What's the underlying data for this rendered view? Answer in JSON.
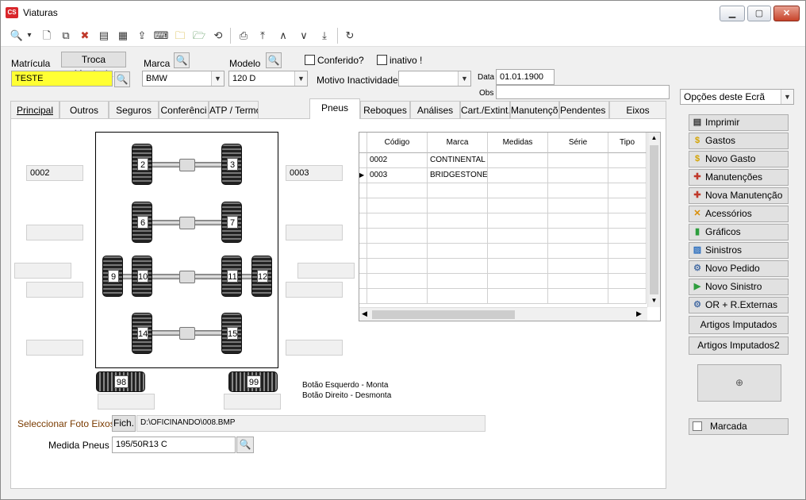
{
  "window": {
    "title": "Viaturas",
    "logo": "CS",
    "minimize": "▁",
    "maximize": "▢",
    "close": "✕"
  },
  "toolbar": {
    "icons": [
      "search-icon",
      "dropdown-arrow-icon",
      "new-document-icon",
      "copy-document-icon",
      "delete-icon",
      "report-icon",
      "table-icon",
      "import-icon",
      "keyboard-icon",
      "find-folder-icon",
      "folder-icon",
      "refresh-icon",
      "preview-icon",
      "first-icon",
      "previous-icon",
      "next-icon",
      "last-icon",
      "reload-icon"
    ],
    "glyphs": {
      "search": "🔍",
      "dropdown": "▾",
      "new": "🗋",
      "copy": "⧉",
      "delete": "✖",
      "report": "▤",
      "table": "▦",
      "import": "⇪",
      "keyboard": "⌨",
      "findfolder": "🗀",
      "folder": "🗁",
      "refresh": "⟲",
      "preview": "⎙",
      "first": "⤒",
      "prev": "∧",
      "next": "∨",
      "last": "⤓",
      "reload": "↻"
    }
  },
  "form": {
    "matricula_label": "Matrícula",
    "matricula_value": "TESTE",
    "troca_button": "Troca Matricula",
    "marca_label": "Marca",
    "marca_value": "BMW",
    "modelo_label": "Modelo",
    "modelo_value": "120 D",
    "conferido_label": "Conferido?",
    "inativo_label": "inativo !",
    "motivo_label": "Motivo Inactividade",
    "motivo_value": "",
    "data_label": "Data",
    "data_value": "01.01.1900",
    "obs_label": "Obs",
    "obs_value": ""
  },
  "tabs": [
    "Principal",
    "Outros",
    "Seguros",
    "Conferênci",
    "ATP / Termó",
    "Pneus",
    "Reboques",
    "Análises",
    "Cart./Extint.",
    "Manutençõe",
    "Pendentes C",
    "Eixos"
  ],
  "active_tab": "Pneus",
  "tyres": {
    "axles": [
      [
        "2",
        "3"
      ],
      [
        "6",
        "7"
      ],
      [
        "9",
        "10",
        "11",
        "12"
      ],
      [
        "14",
        "15"
      ]
    ],
    "spares": [
      "98",
      "99"
    ],
    "left_fields": [
      "0002",
      "",
      "",
      "",
      ""
    ],
    "right_fields": [
      "0003",
      "",
      "",
      "",
      ""
    ],
    "hint_left": "Botão Esquerdo - Monta",
    "hint_right": "Botão Direito - Desmonta"
  },
  "grid": {
    "columns": [
      "Código",
      "Marca",
      "Medidas",
      "Série",
      "Tipo"
    ],
    "rows": [
      [
        "0002",
        "CONTINENTAL",
        "",
        "",
        ""
      ],
      [
        "0003",
        "BRIDGESTONE",
        "",
        "",
        ""
      ]
    ],
    "current_row_marker": "▶"
  },
  "foto": {
    "label": "Seleccionar Foto Eixos",
    "button": "Fich.",
    "path": "D:\\OFICINANDO\\008.BMP"
  },
  "medida": {
    "label": "Medida Pneus",
    "value": "195/50R13 C"
  },
  "side": {
    "options_label": "Opções deste Ecrã",
    "buttons": [
      {
        "label": "Imprimir",
        "icon": "printer-icon",
        "glyph": "▤",
        "color": "#333333"
      },
      {
        "label": "Gastos",
        "icon": "dollar-icon",
        "glyph": "$",
        "color": "#d4a300"
      },
      {
        "label": "Novo Gasto",
        "icon": "dollar-icon",
        "glyph": "$",
        "color": "#d4a300"
      },
      {
        "label": "Manutenções",
        "icon": "maintenance-icon",
        "glyph": "✚",
        "color": "#c0392b"
      },
      {
        "label": "Nova Manutenção",
        "icon": "maintenance-icon",
        "glyph": "✚",
        "color": "#c0392b"
      },
      {
        "label": "Acessórios",
        "icon": "tools-icon",
        "glyph": "✕",
        "color": "#d98c00"
      },
      {
        "label": "Gráficos",
        "icon": "chart-icon",
        "glyph": "▮",
        "color": "#2e9e3e"
      },
      {
        "label": "Sinistros",
        "icon": "accident-icon",
        "glyph": "▨",
        "color": "#2c6fbf"
      },
      {
        "label": "Novo Pedido",
        "icon": "order-icon",
        "glyph": "⚙",
        "color": "#4a6fa5"
      },
      {
        "label": "Novo Sinistro",
        "icon": "new-accident-icon",
        "glyph": "▶",
        "color": "#2e9e3e"
      },
      {
        "label": "OR + R.Externas",
        "icon": "external-icon",
        "glyph": "⚙",
        "color": "#4a6fa5"
      }
    ],
    "artigos": "Artigos Imputados",
    "artigos2": "Artigos Imputados2",
    "photo_glyph": "⊕",
    "marcada": "Marcada"
  }
}
